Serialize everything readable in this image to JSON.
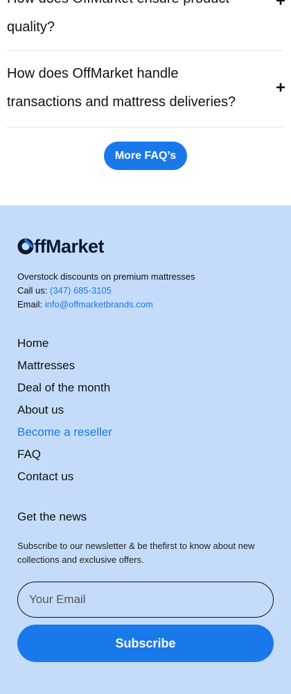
{
  "faq": {
    "items": [
      {
        "question": "How does OffMarket ensure product quality?",
        "toggle": "+"
      },
      {
        "question": "How does OffMarket handle transactions and mattress deliveries?",
        "toggle": "+"
      }
    ],
    "more_button": "More FAQ’s"
  },
  "footer": {
    "logo": {
      "text": "ffMarket",
      "icon": "offmarket-o-logo-icon"
    },
    "tagline": "Overstock discounts on premium mattresses",
    "phone": {
      "label": "Call us:",
      "value": "(347) 685-3105"
    },
    "email": {
      "label": "Email:",
      "value": "info@offmarketbrands.com"
    },
    "nav": [
      {
        "label": "Home"
      },
      {
        "label": "Mattresses"
      },
      {
        "label": "Deal of the month"
      },
      {
        "label": "About us"
      },
      {
        "label": "Become a reseller"
      },
      {
        "label": "FAQ"
      },
      {
        "label": "Contact us"
      }
    ],
    "newsletter": {
      "title": "Get the news",
      "description": "Subscribe to our newsletter & be thefirst to know about new collections and exclusive offers.",
      "email_placeholder": "Your Email",
      "email_value": "",
      "subscribe_label": "Subscribe"
    }
  },
  "colors": {
    "accent": "#1a79ea",
    "footer_bg": "#c4dcf9",
    "logo": "#0a1a33"
  }
}
